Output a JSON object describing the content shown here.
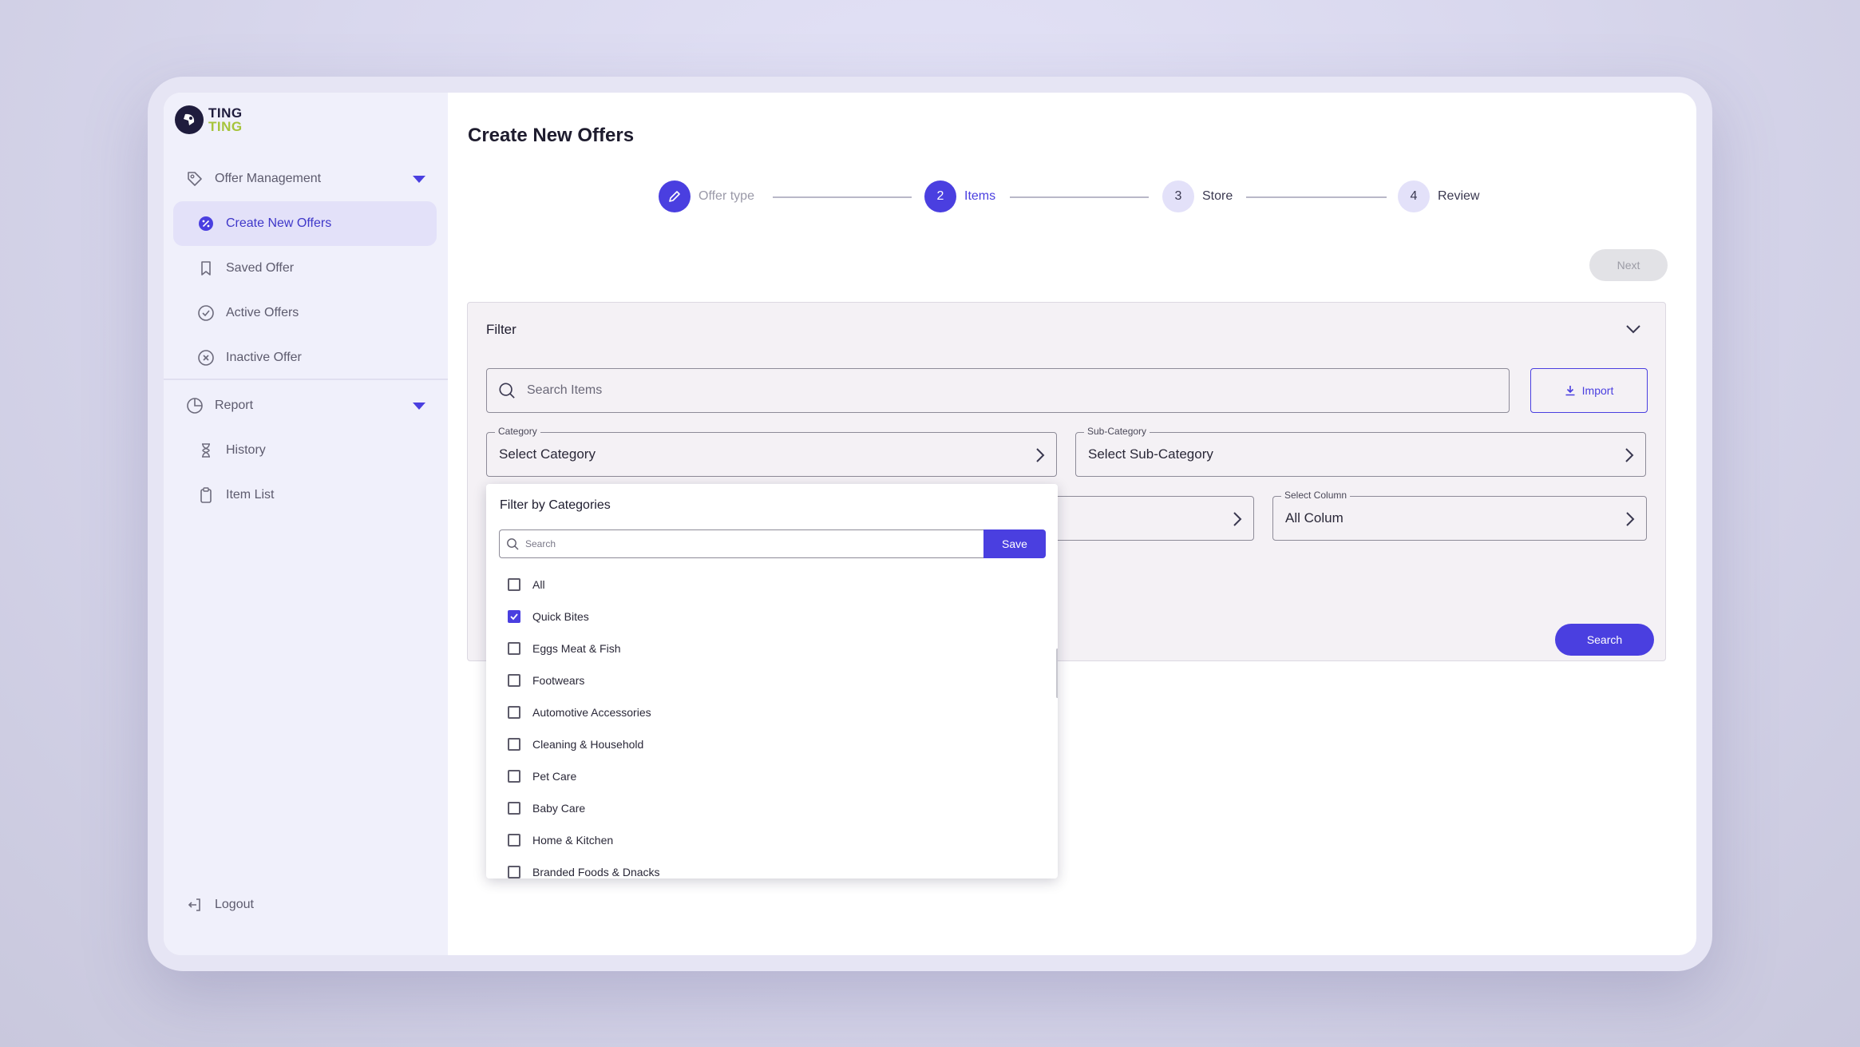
{
  "brand": {
    "line1": "TING",
    "line2": "TING"
  },
  "sidebar": {
    "groups": [
      {
        "label": "Offer Management"
      },
      {
        "label": "Report"
      }
    ],
    "offer_items": [
      {
        "label": "Create New Offers"
      },
      {
        "label": "Saved Offer"
      },
      {
        "label": "Active Offers"
      },
      {
        "label": "Inactive Offer"
      }
    ],
    "report_items": [
      {
        "label": "History"
      },
      {
        "label": "Item List"
      }
    ],
    "logout": "Logout"
  },
  "page": {
    "title": "Create New Offers"
  },
  "stepper": {
    "steps": [
      {
        "number": "",
        "label": "Offer type"
      },
      {
        "number": "2",
        "label": "Items"
      },
      {
        "number": "3",
        "label": "Store"
      },
      {
        "number": "4",
        "label": "Review"
      }
    ]
  },
  "next_label": "Next",
  "filter": {
    "title": "Filter",
    "search_placeholder": "Search Items",
    "import_label": "Import",
    "category": {
      "label": "Category",
      "value": "Select Category"
    },
    "sub_category": {
      "label": "Sub-Category",
      "value": "Select Sub-Category"
    },
    "select_column": {
      "label": "Select Column",
      "value": "All Colum"
    },
    "search_button": "Search"
  },
  "dropdown": {
    "title": "Filter by Categories",
    "search_placeholder": "Search",
    "save_label": "Save",
    "options": [
      {
        "label": "All",
        "checked": false
      },
      {
        "label": "Quick Bites",
        "checked": true
      },
      {
        "label": "Eggs Meat & Fish",
        "checked": false
      },
      {
        "label": "Footwears",
        "checked": false
      },
      {
        "label": "Automotive Accessories",
        "checked": false
      },
      {
        "label": "Cleaning & Household",
        "checked": false
      },
      {
        "label": "Pet Care",
        "checked": false
      },
      {
        "label": "Baby Care",
        "checked": false
      },
      {
        "label": "Home & Kitchen",
        "checked": false
      },
      {
        "label": "Branded Foods & Dnacks",
        "checked": false
      }
    ]
  },
  "colors": {
    "accent": "#4a3fe0",
    "brand_green": "#a6c43b",
    "sidebar_bg": "#f0f0fb"
  }
}
